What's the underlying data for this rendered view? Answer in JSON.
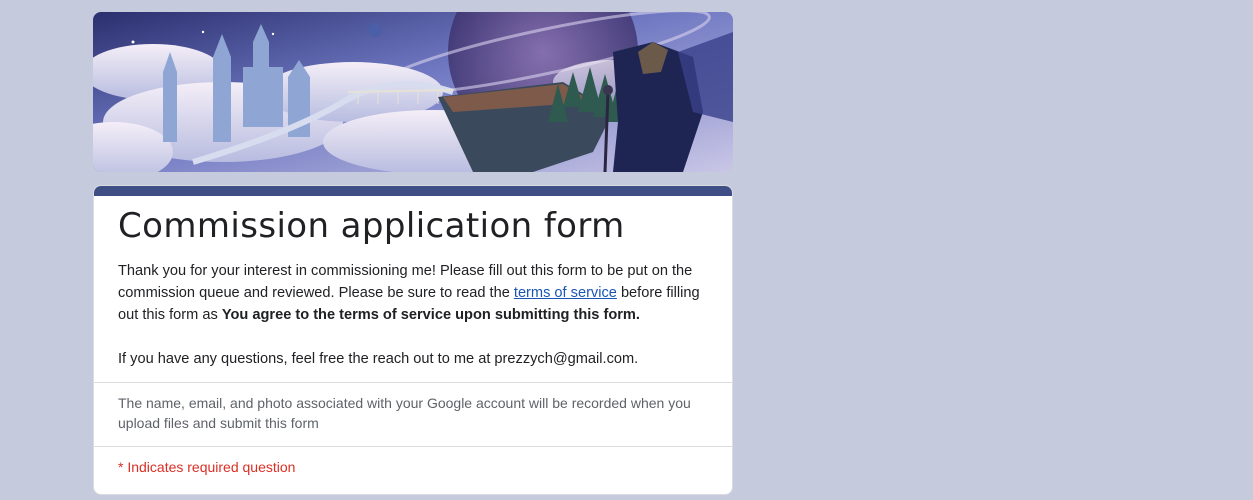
{
  "form": {
    "title": "Commission application form",
    "description": {
      "line1_before_link": "Thank you for your interest in commissioning me! Please fill out this form to be put on the commission queue and reviewed. Please be sure to read the ",
      "tos_link": "terms of service",
      "line1_after_link": " before filling out this form as ",
      "agreement_bold": "You agree to the terms of service upon submitting this form.",
      "contact": "If you have any questions, feel free the reach out to me at prezzych@gmail.com."
    },
    "account_notice": "The name, email, and photo associated with your Google account will be recorded when you upload files and submit this form",
    "required_note": "* Indicates required question"
  },
  "colors": {
    "page_background": "#c5cadc",
    "accent_bar": "#3f4f86",
    "link": "#1a55b6",
    "required": "#d93025"
  }
}
